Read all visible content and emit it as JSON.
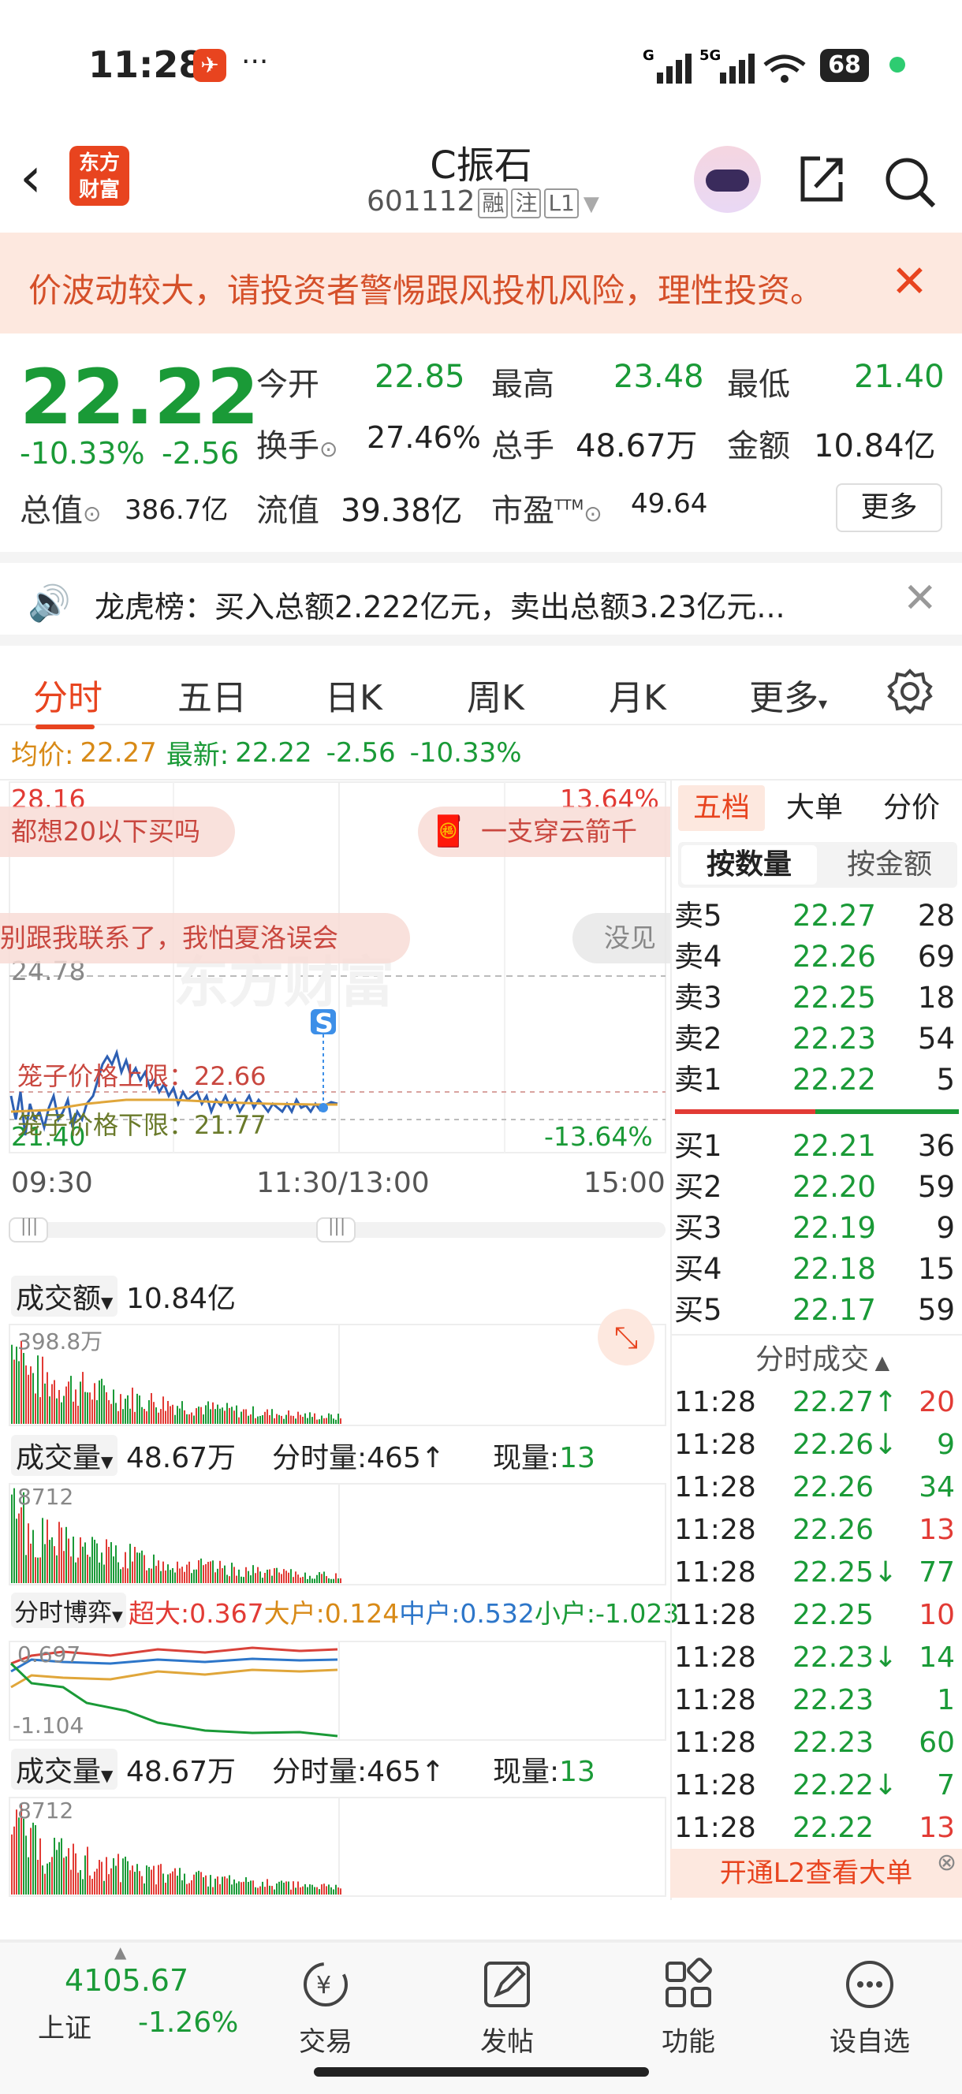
{
  "status": {
    "time": "11:28",
    "app_badge": "✈",
    "dots": "···",
    "battery": "68"
  },
  "header": {
    "stock_name": "C振石",
    "stock_code": "601112",
    "tags": [
      "融",
      "注",
      "L1"
    ],
    "logo_text": "东方财富"
  },
  "warning": {
    "text": "价波动较大，请投资者警惕跟风投机风险，理性投资。"
  },
  "quote": {
    "price": "22.22",
    "pct": "-10.33%",
    "change": "-2.56",
    "open_label": "今开",
    "open": "22.85",
    "high_label": "最高",
    "high": "23.48",
    "low_label": "最低",
    "low": "21.40",
    "turnover_label": "换手",
    "turnover": "27.46%",
    "volume_label": "总手",
    "volume": "48.67万",
    "amount_label": "金额",
    "amount": "10.84亿",
    "mktcap_label": "总值",
    "mktcap": "386.7亿",
    "float_label": "流值",
    "float": "39.38亿",
    "pe_label": "市盈",
    "pe_sup": "TTM",
    "pe": "49.64",
    "more": "更多"
  },
  "dragon": {
    "text": "龙虎榜：买入总额2.222亿元，卖出总额3.23亿元..."
  },
  "tabs": {
    "t1": "分时",
    "t2": "五日",
    "t3": "日K",
    "t4": "周K",
    "t5": "月K",
    "t6": "更多"
  },
  "avg": {
    "label": "均价:",
    "value": "22.27",
    "latest_label": "最新:",
    "latest": "22.22",
    "chg": "-2.56",
    "pct": "-10.33%"
  },
  "chart": {
    "top_price": "28.16",
    "top_pct": "13.64%",
    "mid_price": "24.78",
    "bottom_price": "21.40",
    "bottom_pct": "-13.64%",
    "danmu1": "都想20以下买吗",
    "danmu2": "一支穿云箭千",
    "danmu3": "别跟我联系了，我怕夏洛误会",
    "danmu4": "没见",
    "upper_limit": "笼子价格上限：22.66",
    "lower_limit": "笼子价格下限：21.77",
    "time_start": "09:30",
    "time_mid": "11:30/13:00",
    "time_end": "15:00",
    "marker": "S",
    "watermark": "东方财富",
    "amount_label": "成交额",
    "amount_value": "10.84亿",
    "amount_max": "398.8万",
    "vol_label": "成交量",
    "vol_value": "48.67万",
    "fen_label": "分时量:",
    "fen_value": "465↑",
    "now_label": "现量:",
    "now_value": "13",
    "vol_max": "8712",
    "game_label": "分时博弈",
    "super_label": "超大:",
    "super_value": "0.367",
    "big_label": "大户:",
    "big_value": "0.124",
    "mid_label": "中户:",
    "mid_value": "0.532",
    "small_label": "小户:",
    "small_value": "-1.023",
    "game_top": "0.697",
    "game_bottom": "-1.104",
    "vol2_label": "成交量",
    "vol2_value": "48.67万",
    "fen2_label": "分时量:",
    "fen2_value": "465↑",
    "now2_label": "现量:",
    "now2_value": "13",
    "vol2_max": "8712"
  },
  "orderbook": {
    "tab1": "五档",
    "tab2": "大单",
    "tab3": "分价",
    "sub1": "按数量",
    "sub2": "按金额",
    "sells": [
      [
        "卖5",
        "22.27",
        "28"
      ],
      [
        "卖4",
        "22.26",
        "69"
      ],
      [
        "卖3",
        "22.25",
        "18"
      ],
      [
        "卖2",
        "22.23",
        "54"
      ],
      [
        "卖1",
        "22.22",
        "5"
      ]
    ],
    "buys": [
      [
        "买1",
        "22.21",
        "36"
      ],
      [
        "买2",
        "22.20",
        "59"
      ],
      [
        "买3",
        "22.19",
        "9"
      ],
      [
        "买4",
        "22.18",
        "15"
      ],
      [
        "买5",
        "22.17",
        "59"
      ]
    ],
    "deals_title": "分时成交",
    "deals": [
      [
        "11:28",
        "22.27↑",
        "20"
      ],
      [
        "11:28",
        "22.26↓",
        "9"
      ],
      [
        "11:28",
        "22.26",
        "34"
      ],
      [
        "11:28",
        "22.26",
        "13"
      ],
      [
        "11:28",
        "22.25↓",
        "77"
      ],
      [
        "11:28",
        "22.25",
        "10"
      ],
      [
        "11:28",
        "22.23↓",
        "14"
      ],
      [
        "11:28",
        "22.23",
        "1"
      ],
      [
        "11:28",
        "22.23",
        "60"
      ],
      [
        "11:28",
        "22.22↓",
        "7"
      ],
      [
        "11:28",
        "22.22",
        "13"
      ]
    ],
    "l2": "开通L2查看大单"
  },
  "nav": {
    "index_value": "4105.67",
    "index_name": "上证",
    "index_pct": "-1.26%",
    "trade": "交易",
    "post": "发帖",
    "func": "功能",
    "watch": "设自选"
  }
}
